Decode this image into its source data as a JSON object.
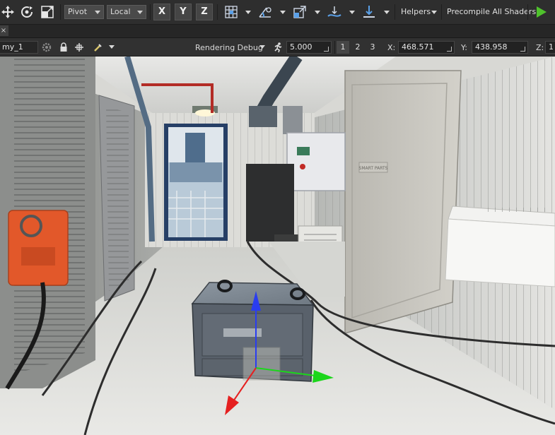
{
  "toolbar": {
    "pivot": "Pivot",
    "local": "Local",
    "axis_x": "X",
    "axis_y": "Y",
    "axis_z": "Z",
    "helpers": "Helpers",
    "precompile": "Precompile All Shaders",
    "icons": [
      "move-icon",
      "rotate-icon",
      "scale-icon",
      "grid-snap-icon",
      "snap-angle-icon",
      "snap-scale-icon",
      "snap-surface-icon",
      "snap-ground-icon",
      "play-icon"
    ]
  },
  "tabs": {
    "close": "×"
  },
  "viewport_toolbar": {
    "object_name": "my_1",
    "rendering_debug": "Rendering Debug",
    "speed": "5.000",
    "view_1": "1",
    "view_2": "2",
    "view_3": "3",
    "x_label": "X:",
    "x_value": "468.571",
    "y_label": "Y:",
    "y_value": "438.958",
    "z_label": "Z:",
    "z_value": "1"
  },
  "scene": {
    "room_sign": "SMART PARTS",
    "gizmo_colors": {
      "x": "#1bd61b",
      "y": "#e52020",
      "z": "#2a3df0"
    },
    "play_color": "#4fc22c"
  }
}
